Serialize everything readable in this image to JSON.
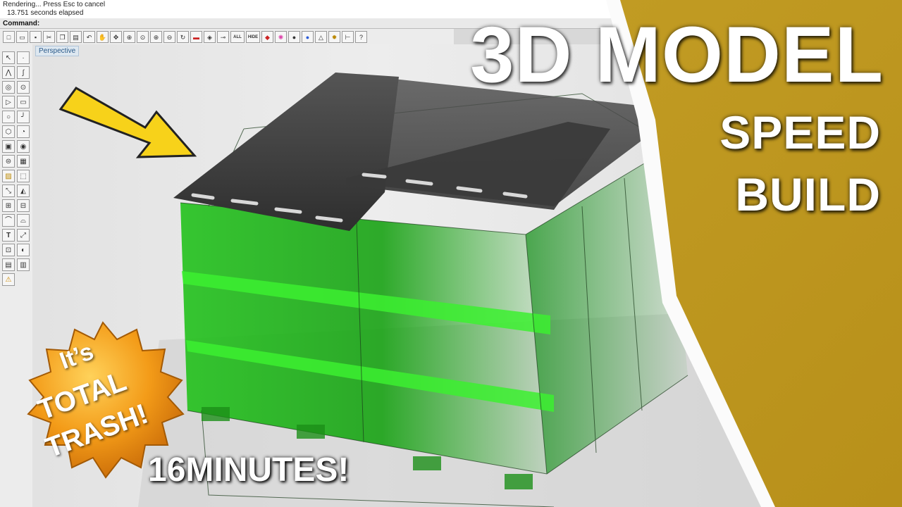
{
  "status": {
    "line1": "Rendering... Press Esc to cancel",
    "line2": "13.751 seconds elapsed"
  },
  "command": {
    "label": "Command:"
  },
  "toolbar": {
    "icons": [
      "new-file-icon",
      "open-folder-icon",
      "save-icon",
      "cut-icon",
      "copy-icon",
      "paste-icon",
      "undo-icon",
      "pan-hand-icon",
      "rotate-view-icon",
      "zoom-window-icon",
      "zoom-extents-icon",
      "zoom-in-icon",
      "zoom-out-icon",
      "refresh-icon",
      "car-icon",
      "layer-icon",
      "lock-icon"
    ],
    "all_label": "ALL",
    "hide_label": "HIDE"
  },
  "viewport": {
    "tab_label": "Perspective"
  },
  "thumbnail": {
    "title_line1": "3D MODEL",
    "title_line2": "SPEED",
    "title_line3": "BUILD",
    "seal_word1": "It’s",
    "seal_word2": "TOTAL",
    "seal_word3": "TRASH!",
    "duration": "16MINUTES!"
  },
  "colors": {
    "dumpster_green": "#22c21c",
    "lid_gray": "#3a3a3a",
    "arrow_yellow": "#f7d21a",
    "panel_yellow": "#c8a42a",
    "seal_orange": "#e88a12"
  }
}
